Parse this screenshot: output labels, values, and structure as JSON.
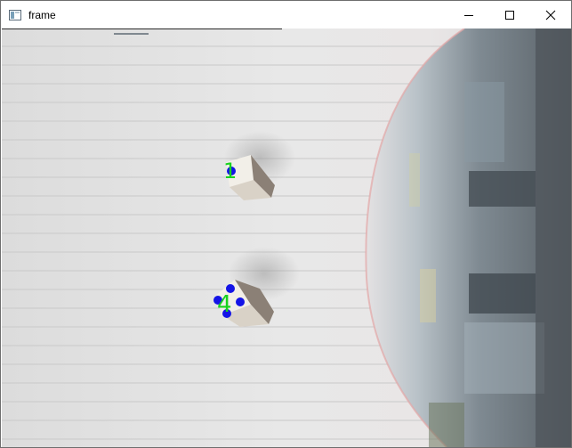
{
  "window": {
    "title": "frame",
    "controls": {
      "minimize": "minimize-icon",
      "maximize": "maximize-icon",
      "close": "close-icon"
    }
  },
  "frame": {
    "markers": [
      {
        "label": "1",
        "color": "#19d21e"
      },
      {
        "label": "4",
        "color": "#19d21e"
      }
    ],
    "keypoint_color": "#1414e6"
  }
}
